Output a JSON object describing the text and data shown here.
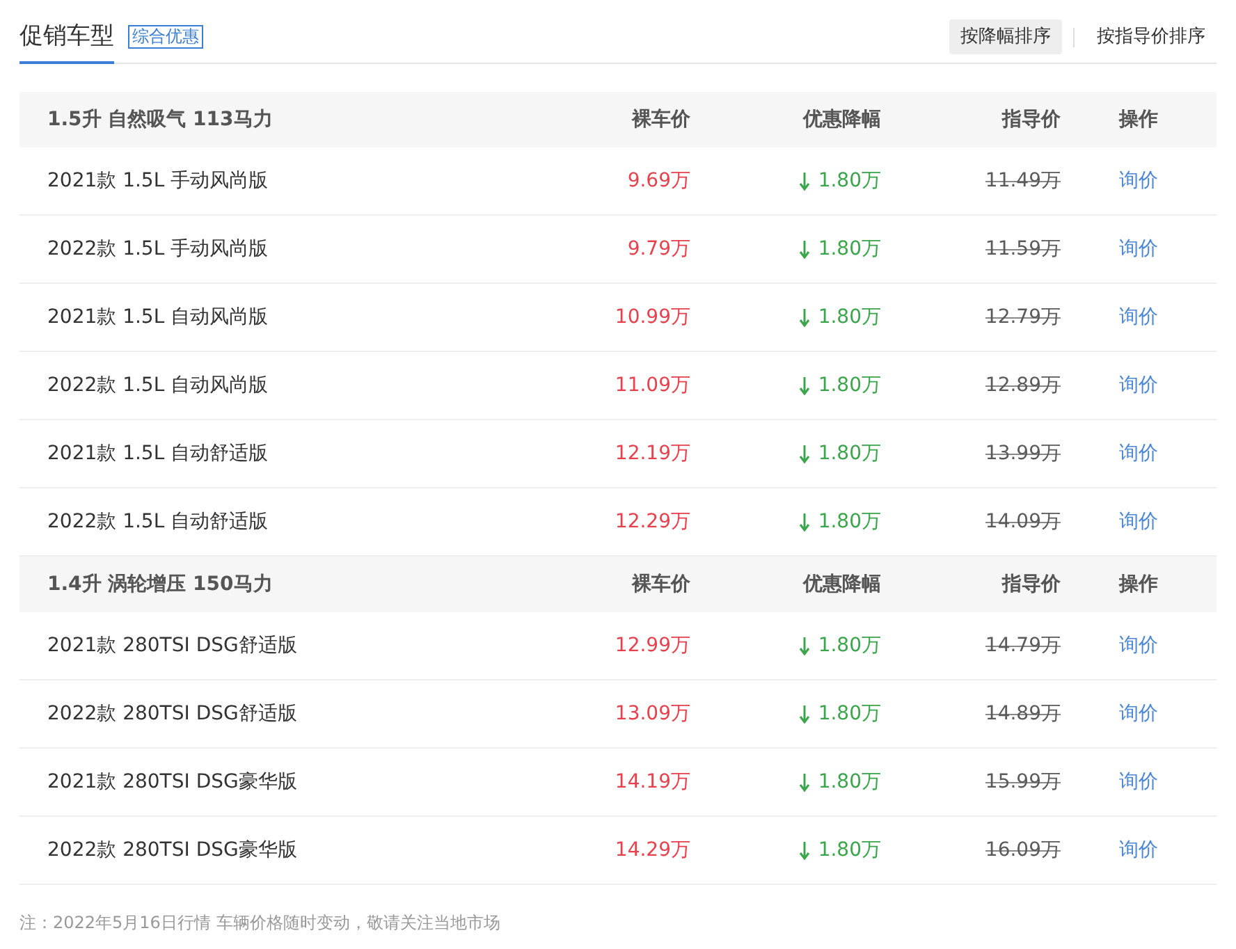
{
  "header": {
    "title": "促销车型",
    "tag": "综合优惠",
    "sort_buttons": [
      {
        "label": "按降幅排序",
        "selected": true
      },
      {
        "label": "按指导价排序",
        "selected": false
      }
    ]
  },
  "groups": [
    {
      "title": "1.5升 自然吸气 113马力",
      "columns": [
        "裸车价",
        "优惠降幅",
        "指导价",
        "操作"
      ],
      "rows": [
        {
          "name": "2021款 1.5L 手动风尚版",
          "price": "9.69万",
          "discount": "1.80万",
          "guide_price": "11.49万",
          "action": "询价"
        },
        {
          "name": "2022款 1.5L 手动风尚版",
          "price": "9.79万",
          "discount": "1.80万",
          "guide_price": "11.59万",
          "action": "询价"
        },
        {
          "name": "2021款 1.5L 自动风尚版",
          "price": "10.99万",
          "discount": "1.80万",
          "guide_price": "12.79万",
          "action": "询价"
        },
        {
          "name": "2022款 1.5L 自动风尚版",
          "price": "11.09万",
          "discount": "1.80万",
          "guide_price": "12.89万",
          "action": "询价"
        },
        {
          "name": "2021款 1.5L 自动舒适版",
          "price": "12.19万",
          "discount": "1.80万",
          "guide_price": "13.99万",
          "action": "询价"
        },
        {
          "name": "2022款 1.5L 自动舒适版",
          "price": "12.29万",
          "discount": "1.80万",
          "guide_price": "14.09万",
          "action": "询价"
        }
      ]
    },
    {
      "title": "1.4升 涡轮增压 150马力",
      "columns": [
        "裸车价",
        "优惠降幅",
        "指导价",
        "操作"
      ],
      "rows": [
        {
          "name": "2021款 280TSI DSG舒适版",
          "price": "12.99万",
          "discount": "1.80万",
          "guide_price": "14.79万",
          "action": "询价"
        },
        {
          "name": "2022款 280TSI DSG舒适版",
          "price": "13.09万",
          "discount": "1.80万",
          "guide_price": "14.89万",
          "action": "询价"
        },
        {
          "name": "2021款 280TSI DSG豪华版",
          "price": "14.19万",
          "discount": "1.80万",
          "guide_price": "15.99万",
          "action": "询价"
        },
        {
          "name": "2022款 280TSI DSG豪华版",
          "price": "14.29万",
          "discount": "1.80万",
          "guide_price": "16.09万",
          "action": "询价"
        }
      ]
    }
  ],
  "footnote": "注：2022年5月16日行情 车辆价格随时变动，敬请关注当地市场"
}
